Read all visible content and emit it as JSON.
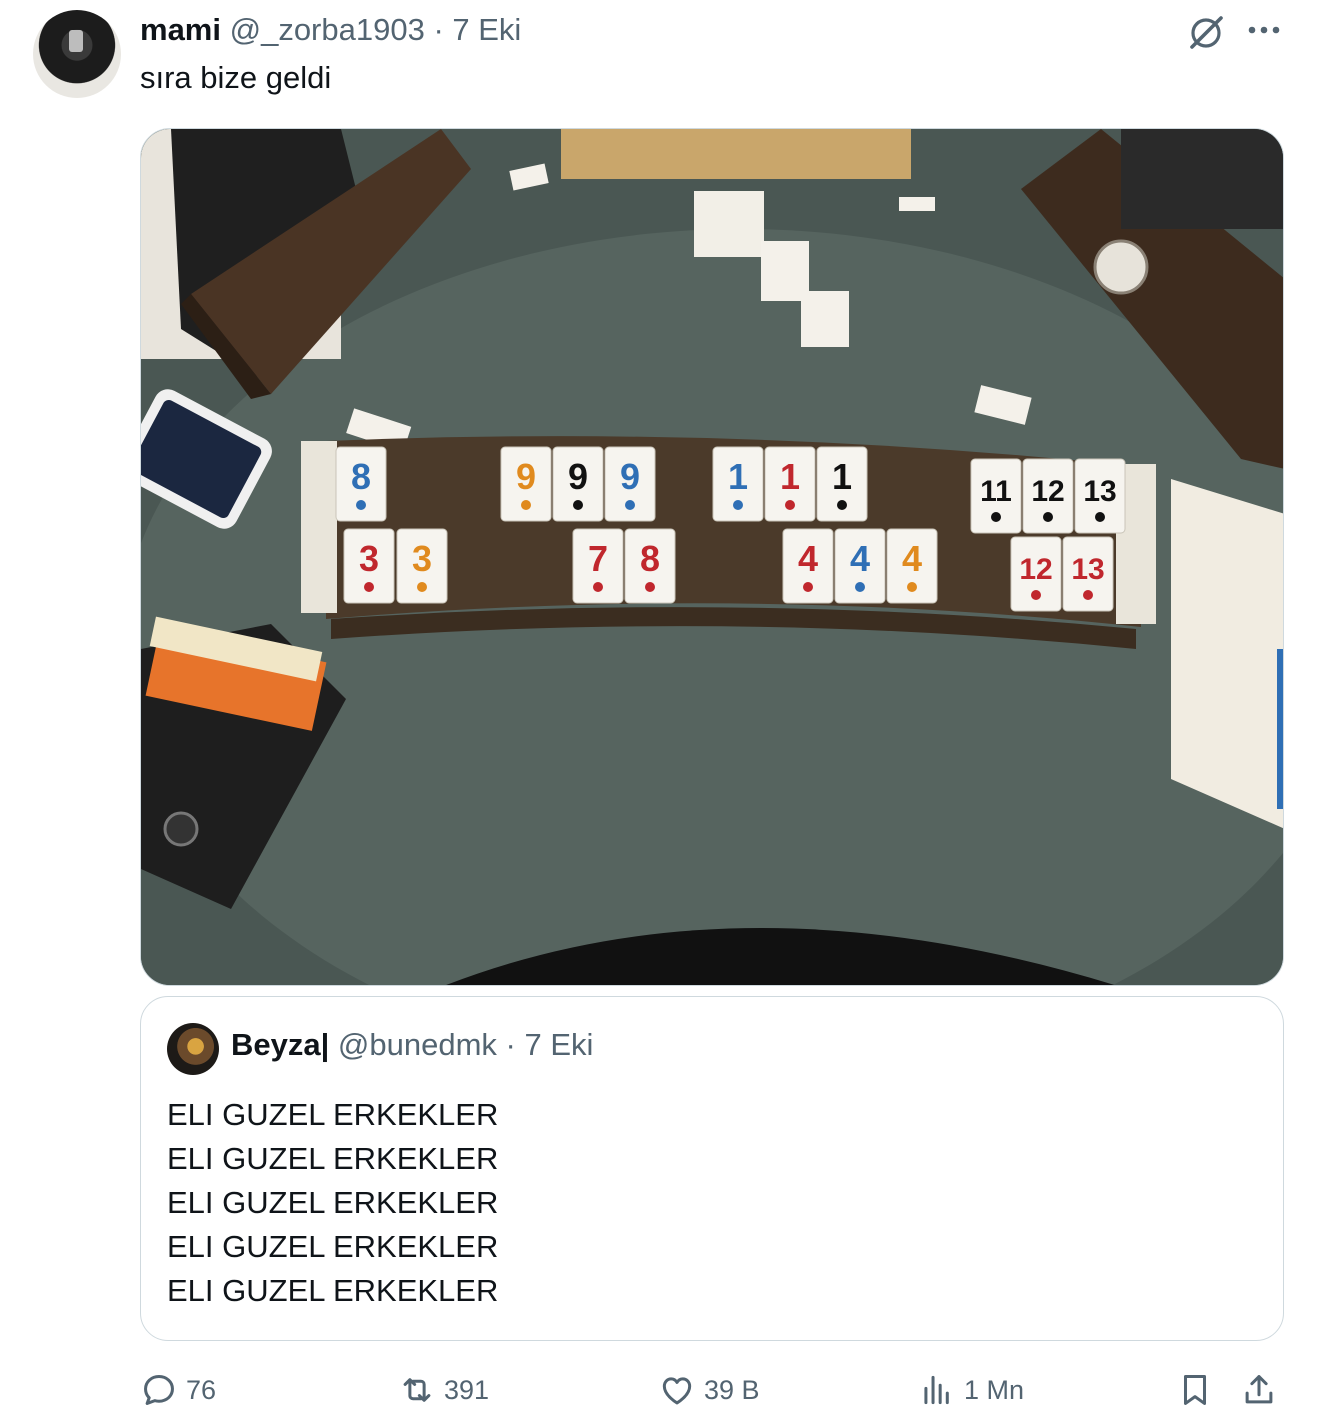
{
  "tweet": {
    "display_name": "mami",
    "handle": "@_zorba1903",
    "separator": "·",
    "date": "7 Eki",
    "text": "sıra bize geldi",
    "image": {
      "rack_top_tiles": [
        "8",
        "9",
        "9",
        "9",
        "1",
        "1",
        "1",
        "11",
        "12",
        "13"
      ],
      "rack_bottom_tiles": [
        "3",
        "3",
        "7",
        "8",
        "4",
        "4",
        "4",
        "12",
        "13"
      ]
    }
  },
  "quote": {
    "display_name": "Beyza|",
    "handle": "@bunedmk",
    "separator": "·",
    "date": "7 Eki",
    "lines": [
      "ELI GUZEL ERKEKLER",
      "ELI GUZEL ERKEKLER",
      "ELI GUZEL ERKEKLER",
      "ELI GUZEL ERKEKLER",
      "ELI GUZEL ERKEKLER"
    ]
  },
  "actions": {
    "reply_count": "76",
    "repost_count": "391",
    "like_count": "39 B",
    "view_count": "1 Mn"
  },
  "icons": {
    "grok": "grok-icon",
    "more": "more-icon",
    "reply": "reply-icon",
    "repost": "repost-icon",
    "like": "like-icon",
    "views": "views-icon",
    "bookmark": "bookmark-icon",
    "share": "share-icon"
  },
  "colors": {
    "text_primary": "#0f1419",
    "text_secondary": "#536471",
    "border": "#cfd9de",
    "tile_red": "#c0272d",
    "tile_blue": "#2f6fb5",
    "tile_orange": "#e08a1e",
    "tile_black": "#111111"
  }
}
